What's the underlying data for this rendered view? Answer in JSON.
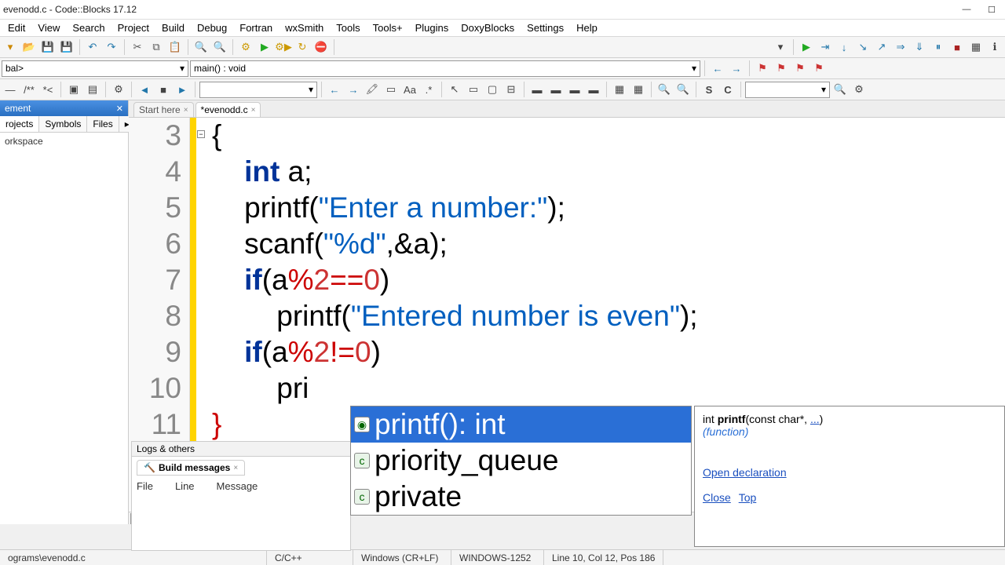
{
  "title": "evenodd.c - Code::Blocks 17.12",
  "menu": [
    "Edit",
    "View",
    "Search",
    "Project",
    "Build",
    "Debug",
    "Fortran",
    "wxSmith",
    "Tools",
    "Tools+",
    "Plugins",
    "DoxyBlocks",
    "Settings",
    "Help"
  ],
  "scope_combo": "bal>",
  "func_combo": "main() : void",
  "side": {
    "title": "ement",
    "tabs": [
      "rojects",
      "Symbols",
      "Files"
    ],
    "workspace_label": "orkspace"
  },
  "tabs": {
    "start": "Start here",
    "active": "*evenodd.c"
  },
  "code": {
    "lines": [
      "3",
      "4",
      "5",
      "6",
      "7",
      "8",
      "9",
      "10",
      "11"
    ],
    "l3": "{",
    "l4_kw": "int",
    "l4_rest": " a;",
    "l5_fn": "printf",
    "l5_open": "(",
    "l5_str": "\"Enter a number:\"",
    "l5_close": ");",
    "l6_fn": "scanf",
    "l6_open": "(",
    "l6_str": "\"%d\"",
    "l6_mid": ",&a",
    "l6_close": ");",
    "l7_kw": "if",
    "l7_open": "(",
    "l7_var": "a",
    "l7_op": "%",
    "l7_num": "2",
    "l7_eq": "==",
    "l7_zero": "0",
    "l7_close": ")",
    "l8_fn": "printf",
    "l8_open": "(",
    "l8_str": "\"Entered number is even\"",
    "l8_close": ");",
    "l9_kw": "if",
    "l9_open": "(",
    "l9_var": "a",
    "l9_op": "%",
    "l9_num": "2",
    "l9_ne": "!=",
    "l9_zero": "0",
    "l9_close": ")",
    "l10_fn": "pri",
    "l11": "}"
  },
  "autocomplete": {
    "items": [
      {
        "label": "printf(): int",
        "selected": true
      },
      {
        "label": "priority_queue",
        "selected": false
      },
      {
        "label": "private",
        "selected": false
      }
    ]
  },
  "tooltip": {
    "prefix": "int ",
    "name": "printf",
    "args": "(const char*, ",
    "dots": "...",
    "suffix": ")",
    "kind": "(function)",
    "link_decl": "Open declaration",
    "link_close": "Close",
    "link_top": "Top"
  },
  "logs": {
    "panel_title": "Logs & others",
    "tab": "Build messages",
    "cols": {
      "file": "File",
      "line": "Line",
      "message": "Message"
    }
  },
  "status": {
    "path": "ograms\\evenodd.c",
    "lang": "C/C++",
    "eol": "Windows (CR+LF)",
    "enc": "WINDOWS-1252",
    "pos": "Line 10, Col 12, Pos 186"
  }
}
